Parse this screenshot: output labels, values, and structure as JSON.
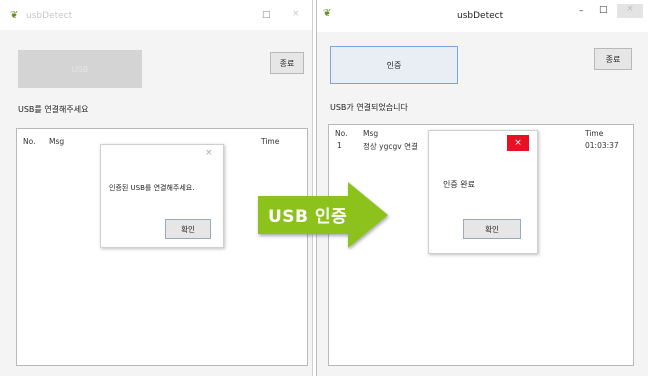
{
  "left_window": {
    "title": "usbDetect",
    "controls": {
      "maximize": "□",
      "close": "×"
    },
    "main_button": "USB",
    "close_button": "종료",
    "status": "USB를 연결해주세요",
    "columns": {
      "no": "No.",
      "msg": "Msg",
      "time": "Time"
    },
    "dialog": {
      "close": "×",
      "message": "인증된 USB를 연결해주세요.",
      "ok": "확인"
    }
  },
  "right_window": {
    "title": "usbDetect",
    "controls": {
      "minimize": "–",
      "maximize": "□",
      "close": "×"
    },
    "main_button": "인증",
    "close_button": "종료",
    "status": "USB가 연결되었습니다",
    "columns": {
      "no": "No.",
      "msg": "Msg",
      "time": "Time"
    },
    "rows": [
      {
        "no": "1",
        "msg": "정상 ygcgv 연결",
        "time": "01:03:37"
      }
    ],
    "dialog": {
      "close": "×",
      "message": "인증 완료",
      "ok": "확인"
    }
  },
  "arrow": {
    "label": "USB 인증",
    "color": "#8dc21f"
  },
  "colors": {
    "dialog_close_red": "#e81123",
    "focus_border": "#7aa6d8"
  }
}
